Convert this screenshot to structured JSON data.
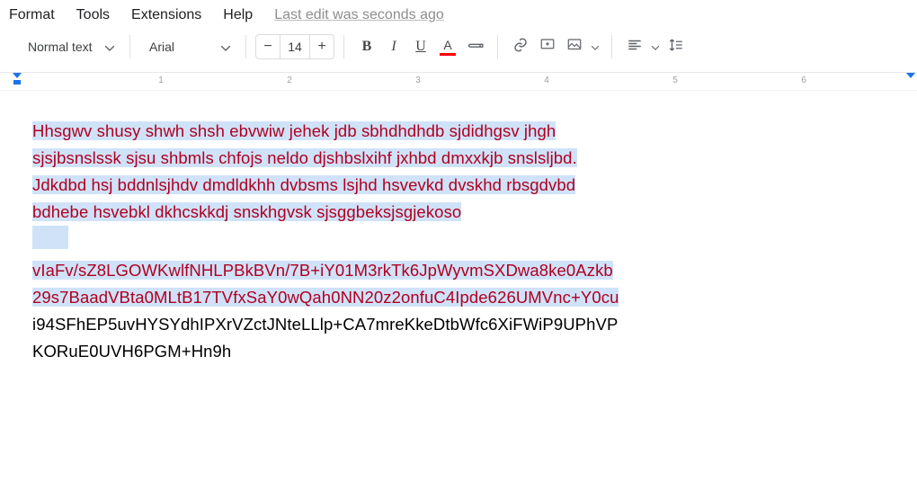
{
  "menu": {
    "format": "Format",
    "tools": "Tools",
    "extensions": "Extensions",
    "help": "Help",
    "last_edit": "Last edit was seconds ago"
  },
  "toolbar": {
    "style_label": "Normal text",
    "font_label": "Arial",
    "font_size": "14",
    "text_color_accent": "#ff0000"
  },
  "ruler": {
    "numbers": [
      "1",
      "2",
      "3",
      "4",
      "5",
      "6"
    ]
  },
  "doc": {
    "para1": {
      "l1": "Hhsgwv shusy shwh shsh ebvwiw jehek jdb sbhdhdhdb sjdidhgsv jhgh",
      "l2": "sjsjbsnslssk sjsu shbmls chfojs neldo djshbslxihf jxhbd dmxxkjb snslsljbd.",
      "l3": "Jdkdbd hsj bddnlsjhdv dmdldkhh dvbsms lsjhd hsvevkd dvskhd rbsgdvbd",
      "l4": "bdhebe hsvebkl dkhcskkdj snskhgvsk sjsggbeksjsgjekoso"
    },
    "para2": {
      "l1": "vIaFv/sZ8LGOWKwlfNHLPBkBVn/7B+iY01M3rkTk6JpWyvmSXDwa8ke0Azkb",
      "l2": "29s7BaadVBta0MLtB17TVfxSaY0wQah0NN20z2onfuC4Ipde626UMVnc+Y0cu",
      "l3": "i94SFhEP5uvHYSYdhIPXrVZctJNteLLlp+CA7mreKkeDtbWfc6XiFWiP9UPhVP",
      "l4": "KORuE0UVH6PGM+Hn9h"
    }
  }
}
